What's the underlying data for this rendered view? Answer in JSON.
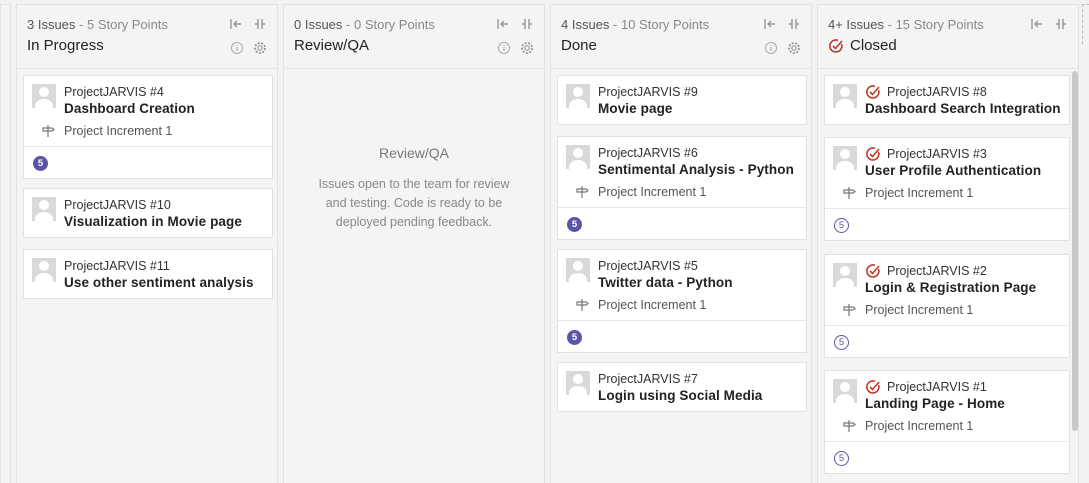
{
  "columns": [
    {
      "issues": "3 Issues",
      "points": "5 Story Points",
      "title": "In Progress",
      "cards": [
        {
          "project": "ProjectJARVIS #4",
          "title": "Dashboard Creation",
          "iteration": "Project Increment 1",
          "points": "5"
        },
        {
          "project": "ProjectJARVIS #10",
          "title": "Visualization in Movie page"
        },
        {
          "project": "ProjectJARVIS #11",
          "title": "Use other sentiment analysis"
        }
      ]
    },
    {
      "issues": "0 Issues",
      "points": "0 Story Points",
      "title": "Review/QA",
      "empty_title": "Review/QA",
      "empty_desc": "Issues open to the team for review and testing. Code is ready to be deployed pending feedback."
    },
    {
      "issues": "4 Issues",
      "points": "10 Story Points",
      "title": "Done",
      "cards": [
        {
          "project": "ProjectJARVIS #9",
          "title": "Movie page"
        },
        {
          "project": "ProjectJARVIS #6",
          "title": "Sentimental Analysis - Python",
          "iteration": "Project Increment 1",
          "points": "5"
        },
        {
          "project": "ProjectJARVIS #5",
          "title": "Twitter data - Python",
          "iteration": "Project Increment 1",
          "points": "5"
        },
        {
          "project": "ProjectJARVIS #7",
          "title": "Login using Social Media"
        }
      ]
    },
    {
      "issues": "4+ Issues",
      "points": "15 Story Points",
      "title": "Closed",
      "cards": [
        {
          "project": "ProjectJARVIS #8",
          "title": "Dashboard Search Integration"
        },
        {
          "project": "ProjectJARVIS #3",
          "title": "User Profile Authentication",
          "iteration": "Project Increment 1",
          "points": "5"
        },
        {
          "project": "ProjectJARVIS #2",
          "title": "Login & Registration Page",
          "iteration": "Project Increment 1",
          "points": "5"
        },
        {
          "project": "ProjectJARVIS #1",
          "title": "Landing Page - Home",
          "iteration": "Project Increment 1",
          "points": "5"
        }
      ]
    }
  ],
  "separator": " - ",
  "colors": {
    "accent_purple": "#5c55a5",
    "closed_red": "#c0392b",
    "background": "#f3f2f1"
  },
  "icons": {
    "collapse": "collapse-column-icon",
    "split": "split-column-icon",
    "info": "info-icon",
    "settings": "gear-icon",
    "iteration": "iteration-signpost-icon",
    "closed": "closed-status-icon",
    "avatar": "avatar"
  }
}
